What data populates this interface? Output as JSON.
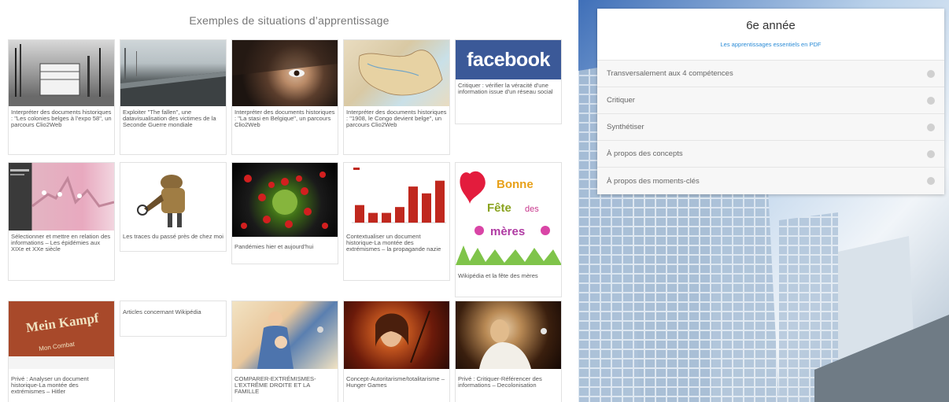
{
  "section": {
    "title": "Exemples de situations d’apprentissage"
  },
  "cards": [
    {
      "caption": "Interpréter des documents historiques : \"Les colonies belges à l'expo 58\", un parcours Clio2Web"
    },
    {
      "caption": "Exploiter \"The fallen\", une datavisualisation des victimes de la Seconde Guerre mondiale"
    },
    {
      "caption": "Interpréter des documents historiques : \"La stasi en Belgique\", un parcours Clio2Web"
    },
    {
      "caption": "Interpréter des documents historiques : \"1908, le Congo devient belge\", un parcours Clio2Web"
    },
    {
      "caption": "Critiquer : vérifier la véracité d'une information issue d'un réseau social",
      "thumb_text": "facebook"
    },
    {
      "caption": "Sélectionner et mettre en relation des informations – Les épidémies aux XIXe et XXe siècle"
    },
    {
      "caption": "Les traces du passé près de chez moi"
    },
    {
      "caption": "Pandémies hier et aujourd'hui"
    },
    {
      "caption": "Contextualiser un document historique-La montée des extrémismes – la propagande nazie"
    },
    {
      "caption": "Wikipédia et la fête des mères",
      "thumb_lines": [
        "Bonne",
        "Fête",
        "des",
        "mères"
      ]
    },
    {
      "caption": "Privé : Analyser un document historique-La montée des extrémismes – Hitler",
      "thumb_lines": [
        "Mein Kampf",
        "Mon Combat"
      ]
    },
    {
      "caption": "Articles concernant Wikipédia"
    },
    {
      "caption": "COMPARER-EXTRÉMISMES-L'EXTRÊME DROITE ET LA FAMILLE"
    },
    {
      "caption": "Concept-Autoritarisme/totalitarisme – Hunger Games"
    },
    {
      "caption": "Privé : Critiquer-Référencer des informations – Decolonisation"
    }
  ],
  "chart_data": {
    "type": "bar",
    "categories": [
      "1",
      "2",
      "3",
      "4",
      "5",
      "6",
      "7"
    ],
    "values": [
      18,
      10,
      10,
      16,
      37,
      30,
      43
    ],
    "ylim": [
      0,
      50
    ]
  },
  "panel": {
    "title": "6e année",
    "link": "Les apprentissages essentiels en PDF",
    "items": [
      "Transversalement aux 4 compétences",
      "Critiquer",
      "Synthétiser",
      "À propos des concepts",
      "À propos des moments-clés"
    ]
  },
  "colors": {
    "facebook": "#3b5998",
    "link": "#2a8bd6",
    "bar": "#c0281e"
  }
}
